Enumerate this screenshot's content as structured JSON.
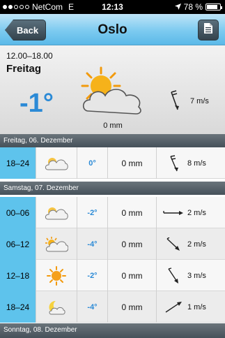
{
  "status": {
    "carrier": "NetCom",
    "network": "E",
    "time": "12:13",
    "battery": "78 %",
    "battery_level": 0.78,
    "signal_bars": 2
  },
  "nav": {
    "back_label": "Back",
    "title": "Oslo"
  },
  "current": {
    "time_range": "12.00–18.00",
    "day": "Freitag",
    "temperature": "-1°",
    "precipitation": "0 mm",
    "wind": "7 m/s",
    "icon": "partly-cloudy-icon",
    "wind_direction_icon": "wind-arrow-icon"
  },
  "days": [
    {
      "header": "Freitag, 06. Dezember",
      "rows": [
        {
          "time": "18–24",
          "icon": "cloudy-icon",
          "temp": "0°",
          "precip": "0 mm",
          "wind": "8 m/s"
        }
      ]
    },
    {
      "header": "Samstag, 07. Dezember",
      "rows": [
        {
          "time": "00–06",
          "icon": "cloudy-icon",
          "temp": "-2°",
          "precip": "0 mm",
          "wind": "2 m/s"
        },
        {
          "time": "06–12",
          "icon": "partly-cloudy-icon",
          "temp": "-4°",
          "precip": "0 mm",
          "wind": "2 m/s"
        },
        {
          "time": "12–18",
          "icon": "sun-icon",
          "temp": "-2°",
          "precip": "0 mm",
          "wind": "3 m/s"
        },
        {
          "time": "18–24",
          "icon": "moon-cloud-icon",
          "temp": "-4°",
          "precip": "0 mm",
          "wind": "1 m/s"
        }
      ]
    },
    {
      "header": "Sonntag, 08. Dezember",
      "rows": []
    }
  ],
  "colors": {
    "accent_blue": "#2b8ad6",
    "time_cell": "#5ec3ec",
    "nav_bar": "#7ccaf0",
    "header_bar": "#52606a"
  }
}
